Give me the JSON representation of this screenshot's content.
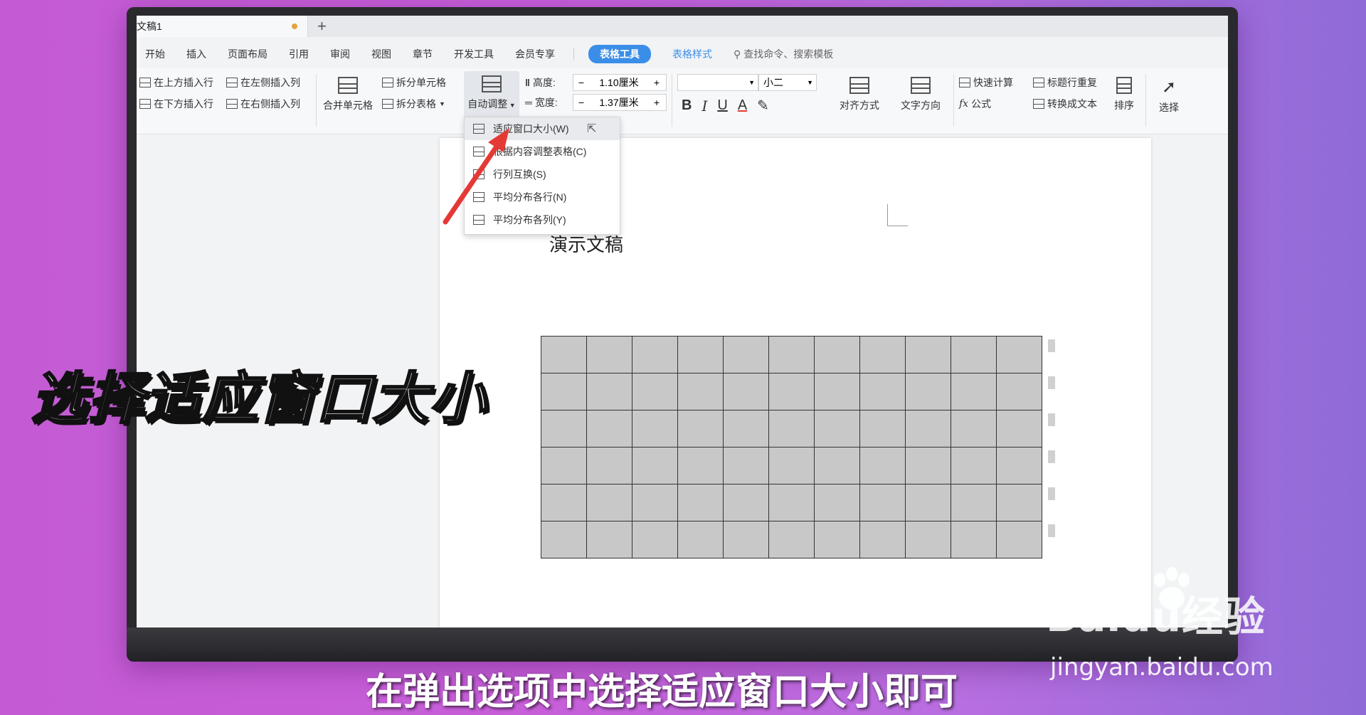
{
  "window": {
    "doc_tab": "文稿1",
    "add_tab": "+"
  },
  "menu": {
    "items": [
      "开始",
      "插入",
      "页面布局",
      "引用",
      "审阅",
      "视图",
      "章节",
      "开发工具",
      "会员专享"
    ],
    "active_tab": "表格工具",
    "style_tab": "表格样式",
    "search": "查找命令、搜索模板"
  },
  "ribbon": {
    "insert_above": "在上方插入行",
    "insert_below": "在下方插入行",
    "insert_left": "在左侧插入列",
    "insert_right": "在右侧插入列",
    "merge_cells": "合并单元格",
    "split_cells": "拆分单元格",
    "split_table": "拆分表格",
    "auto_adjust": "自动调整",
    "height_label": "高度:",
    "height_value": "1.10厘米",
    "width_label": "宽度:",
    "width_value": "1.37厘米",
    "font_size": "小二",
    "align": "对齐方式",
    "text_dir": "文字方向",
    "quick_calc": "快速计算",
    "repeat_header": "标题行重复",
    "formula": "公式",
    "to_text": "转换成文本",
    "sort": "排序",
    "select": "选择"
  },
  "dropdown": {
    "items": [
      "适应窗口大小(W)",
      "根据内容调整表格(C)",
      "行列互换(S)",
      "平均分布各行(N)",
      "平均分布各列(Y)"
    ]
  },
  "document": {
    "title": "演示文稿",
    "table_rows": 6,
    "table_cols": 11
  },
  "captions": {
    "big": "选择适应窗口大小",
    "bottom": "在弹出选项中选择适应窗口大小即可"
  },
  "watermark": {
    "logo": "Baidu经验",
    "url": "jingyan.baidu.com"
  },
  "colors": {
    "accent": "#3b8ee8",
    "arrow": "#e53935",
    "table_fill": "#c8c8c8"
  }
}
